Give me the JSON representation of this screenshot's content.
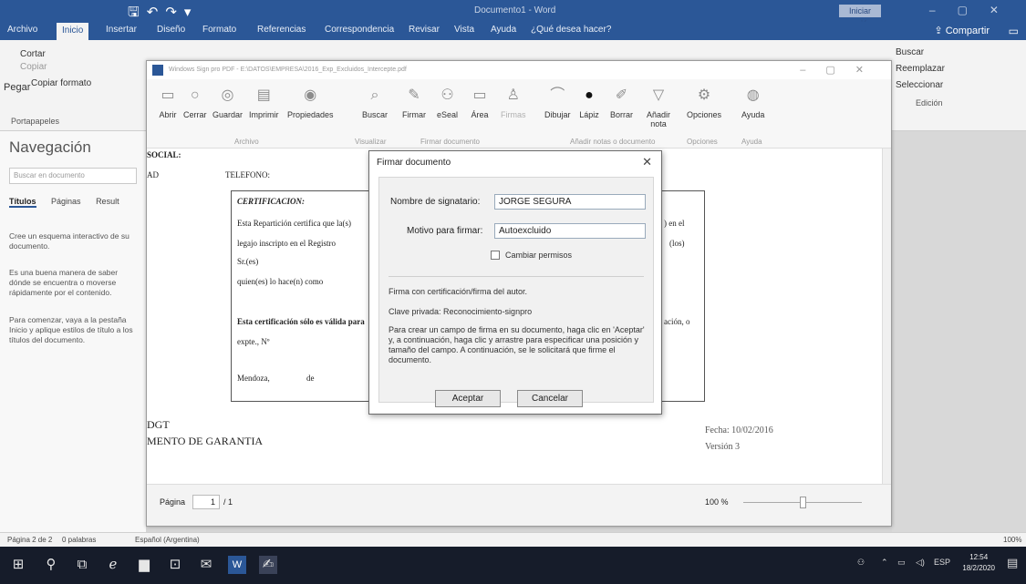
{
  "word": {
    "document_title": "Documento1 - Word",
    "signin": "Iniciar sesión",
    "tabs": [
      "Archivo",
      "Inicio",
      "Insertar",
      "Diseño",
      "Formato",
      "Referencias",
      "Correspondencia",
      "Revisar",
      "Vista",
      "Ayuda",
      "¿Qué desea hacer?"
    ],
    "share": "Compartir",
    "clipboard": {
      "cut": "Cortar",
      "copy": "Copiar",
      "paste": "Pegar",
      "format": "Copiar formato",
      "group": "Portapapeles"
    },
    "editing": {
      "find": "Buscar",
      "replace": "Reemplazar",
      "select": "Seleccionar",
      "group": "Edición"
    },
    "navigation": {
      "title": "Navegación",
      "search_placeholder": "Buscar en documento",
      "tabs": [
        "Títulos",
        "Páginas",
        "Result"
      ],
      "p1": "Cree un esquema interactivo de su documento.",
      "p2": "Es una buena manera de saber dónde se encuentra o moverse rápidamente por el contenido.",
      "p3": "Para comenzar, vaya a la pestaña Inicio y aplique estilos de título a los títulos del documento."
    },
    "status": {
      "page": "Página 2 de 2",
      "words": "0 palabras",
      "lang": "Español (Argentina)",
      "zoom": "100%"
    }
  },
  "pdf": {
    "title": "Windows Sign pro PDF - E:\\DATOS\\EMPRESA\\2016_Exp_Excluidos_Intercepte.pdf",
    "toolbar": {
      "archivo": [
        "Abrir",
        "Cerrar",
        "Guardar",
        "Imprimir",
        "Propiedades"
      ],
      "archivo_group": "Archivo",
      "buscar": "Buscar",
      "visualizar_group": "Visualizar",
      "firmar": [
        "Firmar",
        "eSeal",
        "Área",
        "Firmas"
      ],
      "firmar_group": "Firmar documento",
      "notas": [
        "Dibujar",
        "Lápiz",
        "Borrar",
        "Añadir nota"
      ],
      "notas_group": "Añadir notas o documento",
      "opciones": "Opciones",
      "opciones_group": "Opciones",
      "ayuda": "Ayuda",
      "ayuda_group": "Ayuda"
    },
    "doc": {
      "social": "SOCIAL:",
      "ad": "AD",
      "telefono": "TELEFONO:",
      "cert_title": "CERTIFICACION:",
      "l1": "Esta Repartición certifica que la(s)",
      "l1b": ") en el",
      "l2": "legajo inscripto en el Registro",
      "l2b": "(los)",
      "l3": "Sr.(es)",
      "l4": "quien(es) lo hace(n) como",
      "l5": "Esta certificación sólo es válida para",
      "l5b": "ación, o",
      "l6": "expte., Nº",
      "l7": "Mendoza,",
      "l7b": "de",
      "dgt": "DGT",
      "garantia": "MENTO DE GARANTIA",
      "fecha": "Fecha: 10/02/2016",
      "version": "Versión 3"
    },
    "status": {
      "page_label": "Página",
      "page_value": "1",
      "page_total": "/ 1",
      "zoom": "100 %"
    }
  },
  "dialog": {
    "title": "Firmar documento",
    "signer_label": "Nombre de signatario:",
    "signer_value": "JORGE SEGURA",
    "reason_label": "Motivo para firmar:",
    "reason_value": "Autoexcluido",
    "change_perms": "Cambiar permisos",
    "cert_info": "Firma con certificación/firma del autor.",
    "key_info": "Clave privada: Reconocimiento-signpro",
    "instructions": "Para crear un campo de firma en su documento, haga clic en 'Aceptar' y, a continuación, haga clic y arrastre para especificar una posición y tamaño del campo. A continuación, se le solicitará que firme el documento.",
    "accept": "Aceptar",
    "cancel": "Cancelar"
  },
  "taskbar": {
    "lang": "ESP",
    "time": "12:54",
    "date": "18/2/2020"
  }
}
